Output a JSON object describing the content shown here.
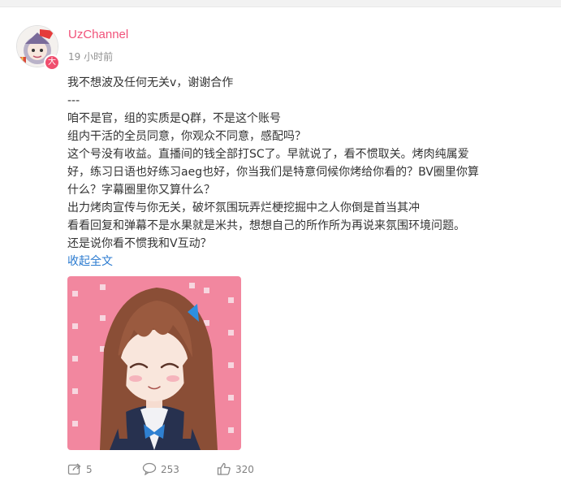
{
  "post": {
    "author": "UzChannel",
    "time": "19 小时前",
    "verify_badge": "大",
    "lines": [
      "我不想波及任何无关v，谢谢合作",
      "---",
      "咱不是官，组的实质是Q群，不是这个账号",
      "组内干活的全员同意，你观众不同意，感配吗？",
      "这个号没有收益。直播间的钱全部打SC了。早就说了，看不惯取关。烤肉纯属爱",
      "好，练习日语也好练习aeg也好，你当我们是特意伺候你烤给你看的？BV圈里你算",
      "什么？字幕圈里你又算什么？",
      "出力烤肉宣传与你无关，破坏氛围玩弄烂梗挖掘中之人你倒是首当其冲",
      "看看回复和弹幕不是水果就是米共，想想自己的所作所为再说来氛围环境问题。",
      "还是说你看不惯我和V互动？"
    ],
    "collapse_label": "收起全文"
  },
  "actions": {
    "repost_count": "5",
    "comment_count": "253",
    "like_count": "320"
  },
  "colors": {
    "username": "#f1527a",
    "link": "#2b7bd0",
    "image_bg": "#f2879f"
  }
}
